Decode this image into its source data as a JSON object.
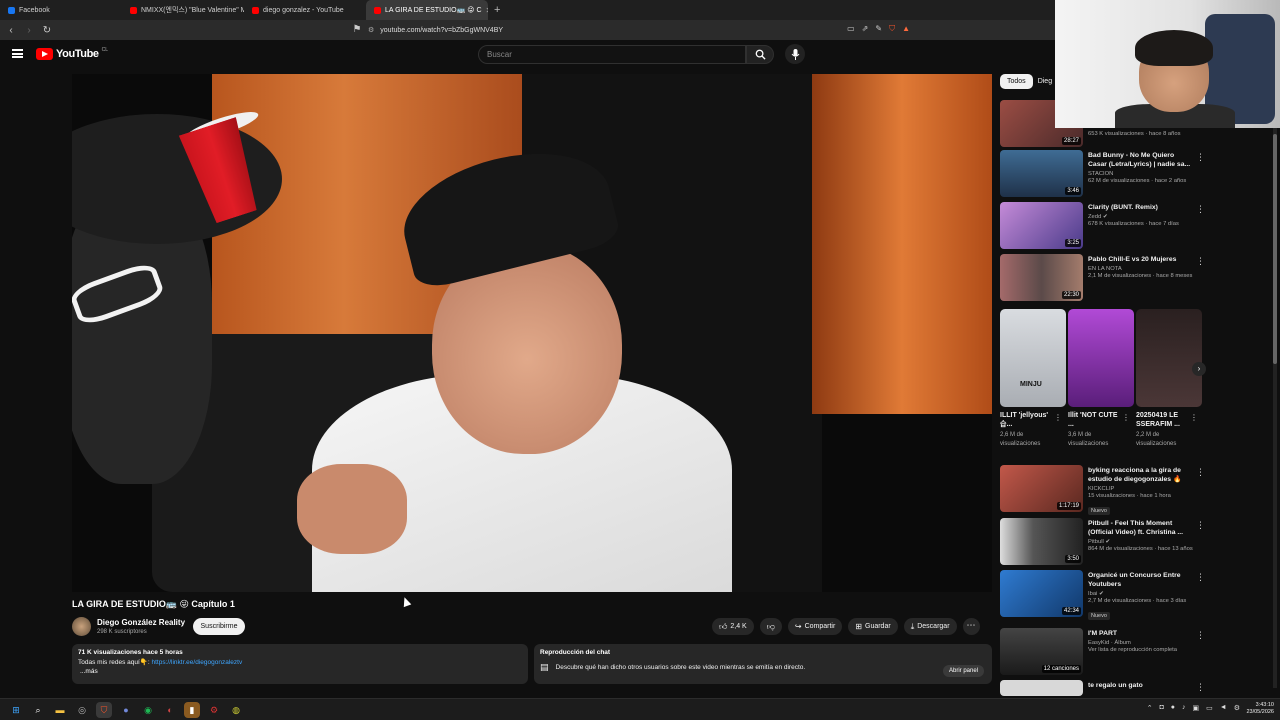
{
  "browser": {
    "tabs": [
      {
        "label": "Facebook",
        "color": "#1877f2"
      },
      {
        "label": "NMIXX(엔믹스) \"Blue Valentine\" M/V",
        "color": "#ff0000"
      },
      {
        "label": "diego gonzalez - YouTube",
        "color": "#ff0000"
      },
      {
        "label": "LA GIRA DE ESTUDIO🚌 😜 C",
        "color": "#ff0000",
        "active": true
      }
    ],
    "url": "youtube.com/watch?v=bZbGgWNV4BY"
  },
  "header": {
    "logo_text": "YouTube",
    "country": "CL",
    "search_placeholder": "Buscar"
  },
  "video": {
    "title": "LA GIRA DE ESTUDIO🚌 😜 Capítulo 1",
    "channel": "Diego González Reality",
    "subs": "298 K suscriptores",
    "subscribe_label": "Suscribirme",
    "likes": "2,4 K",
    "share_label": "Compartir",
    "save_label": "Guardar",
    "download_label": "Descargar"
  },
  "description": {
    "meta": "71 K visualizaciones  hace 5 horas",
    "line": "Todas mis redes aquí👇: ",
    "link": "https://linktr.ee/diegogonzaleztv",
    "more": "...más"
  },
  "chat_replay": {
    "heading": "Reproducción del chat",
    "text": "Descubre qué han dicho otros usuarios sobre este video mientras se emitía en directo.",
    "open_label": "Abrir panel"
  },
  "chips": [
    "Todos",
    "Dieg"
  ],
  "recommendations_top": [
    {
      "title": "",
      "channel": "",
      "stats": "653 K visualizaciones · hace 8 años",
      "duration": "28:27",
      "color": "#7a3f39"
    },
    {
      "title": "Bad Bunny - No Me Quiero Casar (Letra/Lyrics) | nadie sa...",
      "channel": "STACION",
      "stats": "62 M de visualizaciones · hace 2 años",
      "duration": "3:46",
      "color": "#2f4b6b"
    },
    {
      "title": "Clarity (BUNT. Remix)",
      "channel": "Zedd ✔",
      "stats": "678 K visualizaciones · hace 7 días",
      "duration": "3:25",
      "color": "#7b5ea8"
    },
    {
      "title": "Pablo Chill-E vs 20 Mujeres",
      "channel": "EN LA NOTA",
      "stats": "2,1 M de visualizaciones · hace 8 meses",
      "duration": "22:30",
      "color": "#6c5a58"
    }
  ],
  "shorts": [
    {
      "title": "ILLIT 'jellyous' 습...",
      "views": "2,6 M de visualizaciones",
      "label": "MINJU",
      "color": "#bfc3c9"
    },
    {
      "title": "Illit 'NOT CUTE ...",
      "views": "3,6 M de visualizaciones",
      "label": "",
      "color": "#8a3fb0"
    },
    {
      "title": "20250419 LE SSERAFIM ...",
      "views": "2,2 M de visualizaciones",
      "label": "",
      "color": "#3b2a2a"
    }
  ],
  "recommendations_bottom": [
    {
      "title": "byking reacciona a la gira de estudio de diegogonzales 🔥",
      "channel": "KICKCLIP",
      "stats": "15 visualizaciones · hace 1 hora",
      "duration": "1:17:19",
      "badge": "Nuevo",
      "color": "#8d3b30"
    },
    {
      "title": "Pitbull - Feel This Moment (Official Video) ft. Christina ...",
      "channel": "Pitbull ✔",
      "stats": "864 M de visualizaciones · hace 13 años",
      "duration": "3:50",
      "badge": "",
      "color": "#3a3a3a"
    },
    {
      "title": "Organicé un Concurso Entre Youtubers",
      "channel": "Ibai ✔",
      "stats": "2,7 M de visualizaciones · hace 3 días",
      "duration": "42:34",
      "badge": "Nuevo",
      "color": "#1e5fa8"
    },
    {
      "title": "I'M PART",
      "channel": "EasyKid · Álbum",
      "stats": "Ver lista de reproducción completa",
      "duration": "12 canciones",
      "badge": "",
      "color": "#2a2a2a"
    },
    {
      "title": "te regalo un gato",
      "channel": "",
      "stats": "",
      "duration": "",
      "badge": "",
      "color": "#cfcfcf"
    }
  ],
  "taskbar": {
    "time": "3:43:10",
    "date": "23/05/2026"
  }
}
